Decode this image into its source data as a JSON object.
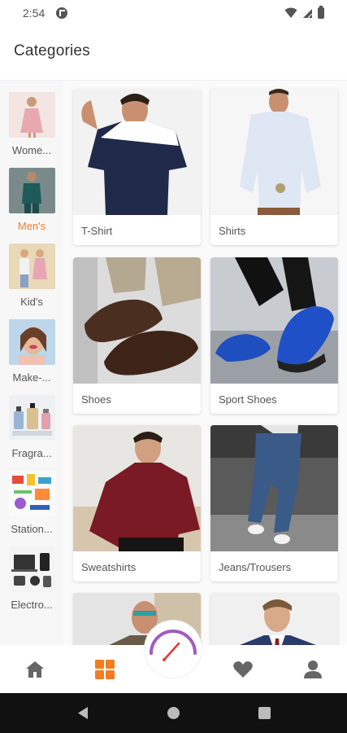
{
  "status_bar": {
    "time": "2:54"
  },
  "header": {
    "title": "Categories"
  },
  "sidebar": {
    "items": [
      {
        "label": "Wome..."
      },
      {
        "label": "Men's"
      },
      {
        "label": "Kid's"
      },
      {
        "label": "Make-..."
      },
      {
        "label": "Fragra..."
      },
      {
        "label": "Station..."
      },
      {
        "label": "Electro..."
      }
    ]
  },
  "grid": {
    "cards": [
      {
        "label": "T-Shirt"
      },
      {
        "label": "Shirts"
      },
      {
        "label": "Shoes"
      },
      {
        "label": "Sport Shoes"
      },
      {
        "label": "Sweatshirts"
      },
      {
        "label": "Jeans/Trousers"
      },
      {
        "label": ""
      },
      {
        "label": ""
      }
    ]
  },
  "colors": {
    "accent": "#f47b20",
    "fab_ring": "#a05cc0"
  },
  "bottom_nav": {
    "icons": [
      "home-icon",
      "categories-icon",
      "speedometer-icon",
      "heart-icon",
      "user-icon"
    ]
  }
}
